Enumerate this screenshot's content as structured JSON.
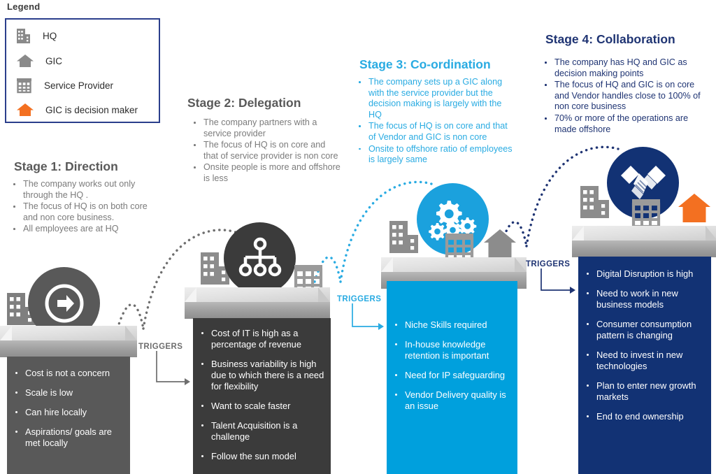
{
  "legend": {
    "title": "Legend",
    "items": [
      {
        "icon": "office-building-icon",
        "label": "HQ",
        "color": "#8a8a8a"
      },
      {
        "icon": "house-icon",
        "label": "GIC",
        "color": "#8a8a8a"
      },
      {
        "icon": "grid-building-icon",
        "label": "Service Provider",
        "color": "#8a8a8a"
      },
      {
        "icon": "house-icon-orange",
        "label": "GIC  is decision maker",
        "color": "#f37021"
      }
    ]
  },
  "colors": {
    "stage1": "#595959",
    "stage1_panel": "#595959",
    "stage2": "#3b3b3b",
    "stage3": "#00a0dd",
    "stage3_title": "#29abe2",
    "stage4": "#123274",
    "stage4_title": "#1f3473",
    "orange": "#f37021",
    "legend_border": "#2b3f8c",
    "platform_top": "#e2e2e2",
    "platform_front": "#9e9e9e"
  },
  "stages": [
    {
      "id": "stage-1",
      "title": "Stage 1: Direction",
      "badge_icon": "arrow-right-circle-icon",
      "buildings": [
        "office-building-icon"
      ],
      "description": [
        "The company works out only through the HQ .",
        "The focus of HQ is on both core and non core business.",
        "All employees are at HQ"
      ],
      "panel": [
        "Cost is not a concern",
        "Scale is low",
        "Can hire locally",
        "Aspirations/ goals are met locally"
      ]
    },
    {
      "id": "stage-2",
      "title": "Stage 2: Delegation",
      "badge_icon": "org-hierarchy-icon",
      "buildings": [
        "office-building-icon",
        "grid-building-icon"
      ],
      "description": [
        "The company partners with a service provider",
        "The focus of HQ is on core and that of service provider is non core",
        "Onsite people is more and offshore is less"
      ],
      "panel": [
        "Cost of IT is high as a percentage of revenue",
        "Business variability is high due to which there is a need for flexibility",
        "Want to scale faster",
        "Talent Acquisition is a challenge",
        "Follow the sun model"
      ]
    },
    {
      "id": "stage-3",
      "title": "Stage 3: Co-ordination",
      "badge_icon": "gears-icon",
      "buildings": [
        "office-building-icon",
        "grid-building-icon",
        "house-icon"
      ],
      "description": [
        "The company sets up a GIC along with the service provider but the decision making is largely with the HQ",
        "The focus of HQ is on core and that of Vendor and GIC is non core",
        "Onsite to offshore ratio of employees is largely same"
      ],
      "panel": [
        "Niche Skills required",
        "In-house knowledge retention is important",
        "Need for IP safeguarding",
        "Vendor Delivery quality is an issue"
      ]
    },
    {
      "id": "stage-4",
      "title": "Stage 4: Collaboration",
      "badge_icon": "handshake-icon",
      "buildings": [
        "office-building-icon",
        "grid-building-icon",
        "house-icon-orange"
      ],
      "description": [
        "The company has HQ and GIC as decision making points",
        "The focus of HQ and GIC is on core and Vendor handles close to 100% of non core business",
        "70% or more of the operations are made offshore"
      ],
      "panel": [
        "Digital Disruption is high",
        "Need to work in new business models",
        "Consumer consumption pattern is changing",
        "Need to invest in new technologies",
        "Plan to enter new growth markets",
        "End to end ownership"
      ]
    }
  ],
  "connectors": [
    {
      "label": "TRIGGERS",
      "color": "#6e6e6e"
    },
    {
      "label": "TRIGGERS",
      "color": "#29abe2"
    },
    {
      "label": "TRIGGERS",
      "color": "#1f3473"
    }
  ]
}
